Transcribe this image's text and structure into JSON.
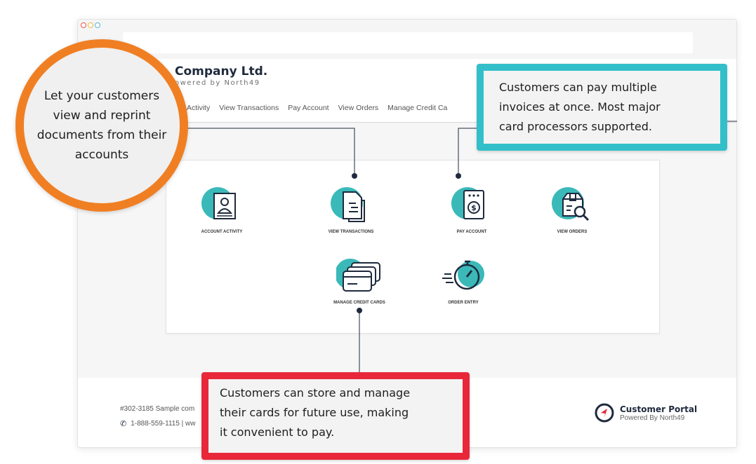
{
  "brand": {
    "name": "Company Ltd.",
    "sub": "owered by North49"
  },
  "nav": {
    "items": [
      "unt Activity",
      "View Transactions",
      "Pay Account",
      "View Orders",
      "Manage Credit Ca"
    ]
  },
  "tiles": [
    {
      "label": "ACCOUNT ACTIVITY",
      "icon": "account-activity-icon"
    },
    {
      "label": "VIEW TRANSACTIONS",
      "icon": "view-transactions-icon"
    },
    {
      "label": "PAY ACCOUNT",
      "icon": "pay-account-icon"
    },
    {
      "label": "VIEW ORDERS",
      "icon": "view-orders-icon"
    },
    {
      "label": "MANAGE CREDIT CARDS",
      "icon": "manage-credit-cards-icon"
    },
    {
      "label": "ORDER ENTRY",
      "icon": "order-entry-icon"
    }
  ],
  "footer": {
    "address": "#302-3185 Sample com",
    "phone": "1-888-559-1115  |  ww",
    "portal_title": "Customer Portal",
    "portal_sub": "Powered By North49"
  },
  "callouts": {
    "orange": "Let your customers view and reprint documents from their accounts",
    "teal_lines": [
      "Customers can pay multiple",
      "invoices at once. Most major",
      "card processors supported."
    ],
    "red_lines": [
      "Customers can store and manage",
      "their cards for future use, making",
      "it convenient to pay."
    ]
  },
  "colors": {
    "teal": "#33bfc9",
    "orange": "#f07f23",
    "red": "#e8283a",
    "navy": "#1f2a3d"
  }
}
